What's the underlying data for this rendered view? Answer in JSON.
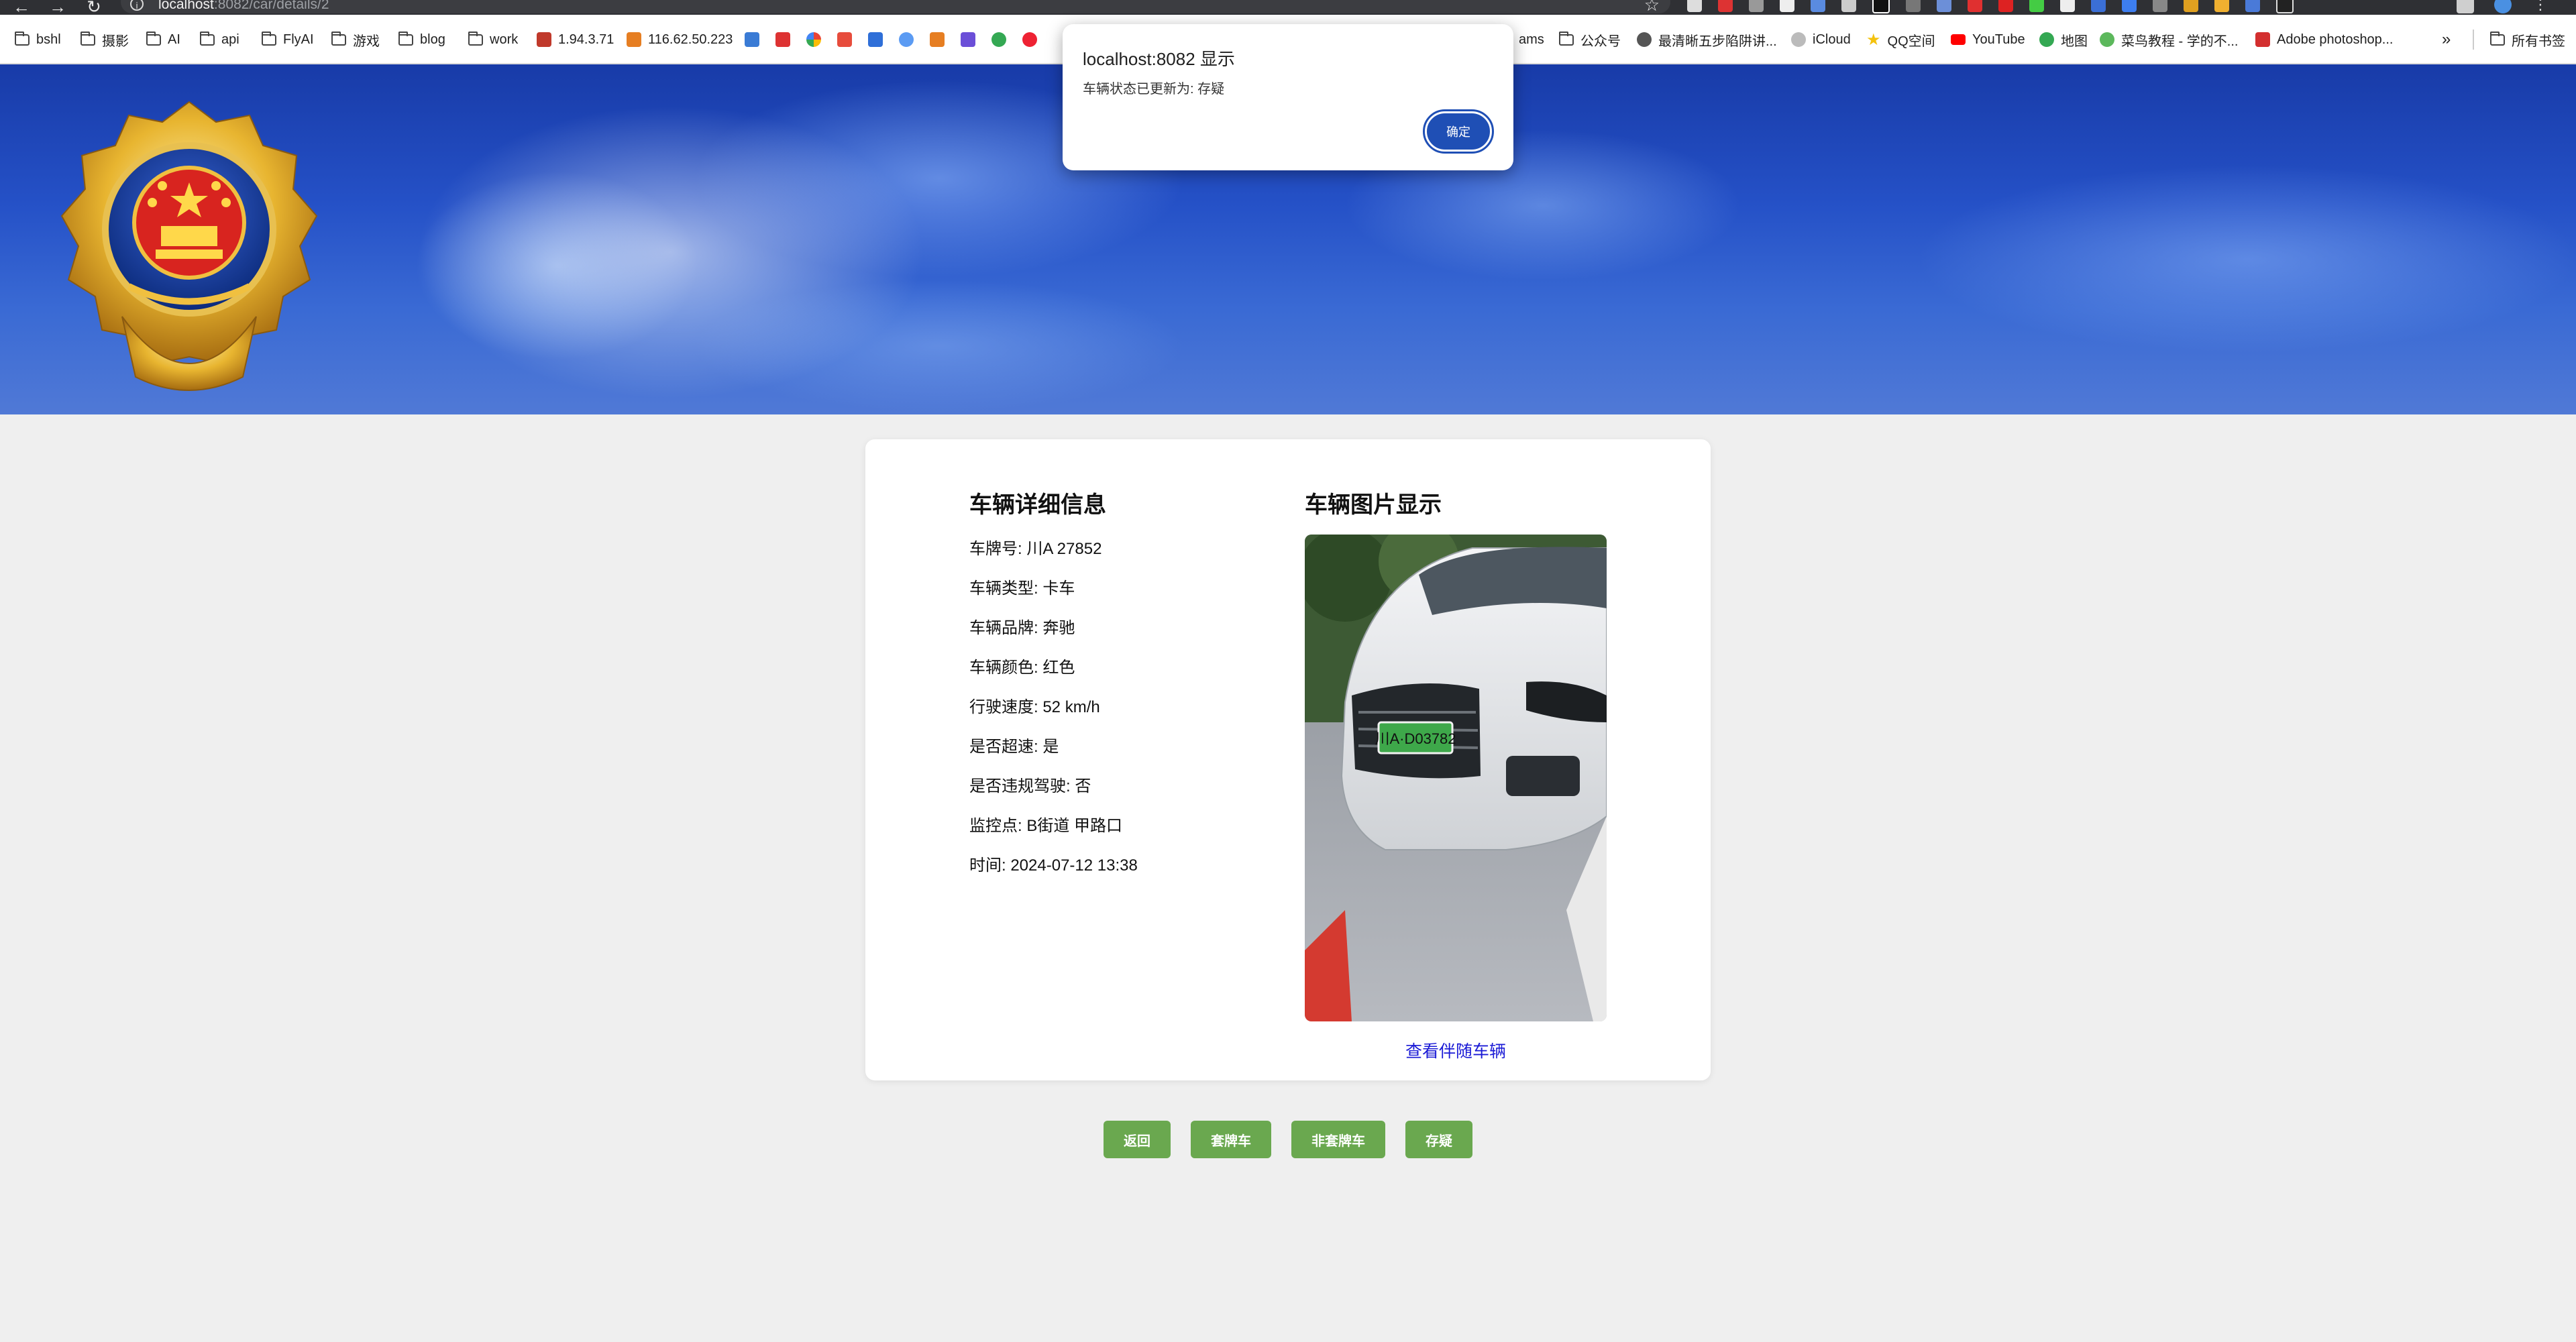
{
  "browser": {
    "url_host": "localhost",
    "url_path": ":8082/car/details/2",
    "bookmarks": [
      {
        "label": "bshl",
        "icon": "folder"
      },
      {
        "label": "摄影",
        "icon": "folder"
      },
      {
        "label": "AI",
        "icon": "folder"
      },
      {
        "label": "api",
        "icon": "folder"
      },
      {
        "label": "FlyAI",
        "icon": "folder"
      },
      {
        "label": "游戏",
        "icon": "folder"
      },
      {
        "label": "blog",
        "icon": "folder"
      },
      {
        "label": "work",
        "icon": "folder"
      },
      {
        "label": "1.94.3.71",
        "icon": "site"
      },
      {
        "label": "116.62.50.223",
        "icon": "site"
      },
      {
        "label": "ams",
        "icon": "none"
      },
      {
        "label": "公众号",
        "icon": "folder"
      },
      {
        "label": "最清晰五步陷阱讲...",
        "icon": "site"
      },
      {
        "label": "iCloud",
        "icon": "apple"
      },
      {
        "label": "QQ空间",
        "icon": "star"
      },
      {
        "label": "YouTube",
        "icon": "youtube"
      },
      {
        "label": "地图",
        "icon": "map"
      },
      {
        "label": "菜鸟教程 - 学的不...",
        "icon": "runoob"
      },
      {
        "label": "Adobe photoshop...",
        "icon": "adobe"
      },
      {
        "label": "所有书签",
        "icon": "folder"
      }
    ],
    "more_chevron": "»"
  },
  "dialog": {
    "title": "localhost:8082 显示",
    "message": "车辆状态已更新为: 存疑",
    "ok_label": "确定"
  },
  "details": {
    "title": "车辆详细信息",
    "lines": [
      "车牌号: 川A 27852",
      "车辆类型: 卡车",
      "车辆品牌: 奔驰",
      "车辆颜色: 红色",
      "行驶速度: 52 km/h",
      "是否超速: 是",
      "是否违规驾驶: 否",
      "监控点: B街道 甲路口",
      "时间: 2024-07-12 13:38"
    ]
  },
  "photo_section": {
    "title": "车辆图片显示",
    "plate_in_photo": "川A·D03782",
    "link_label": "查看伴随车辆"
  },
  "actions": {
    "back": "返回",
    "cloned_plate": "套牌车",
    "not_cloned_plate": "非套牌车",
    "suspicious": "存疑"
  },
  "colors": {
    "button_green": "#6aa84f",
    "link_blue": "#1a1ad6",
    "dialog_button": "#1f4fb5",
    "banner_blue": "#2551c7"
  }
}
